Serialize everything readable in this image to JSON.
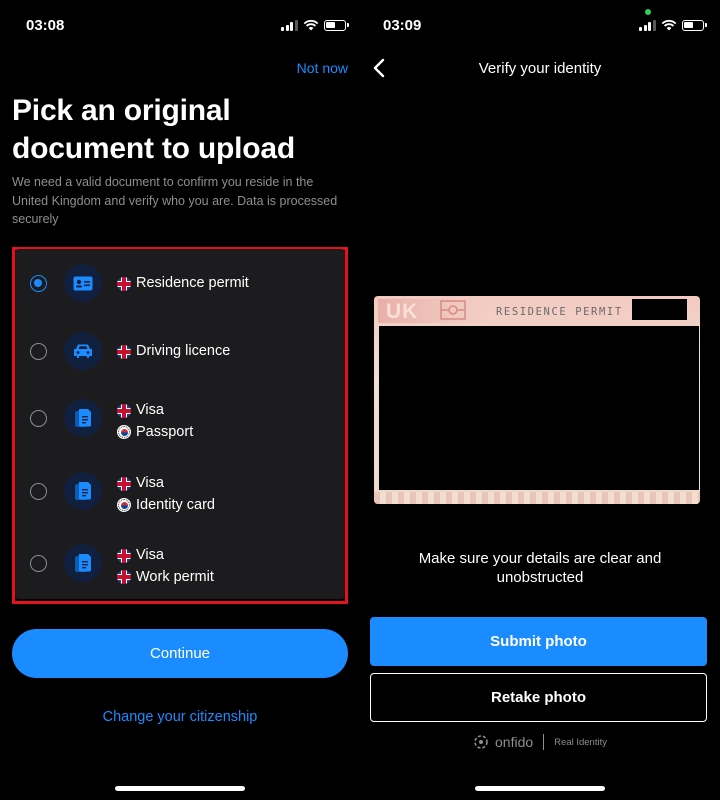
{
  "left_screen": {
    "status_bar": {
      "time": "03:08"
    },
    "header": {
      "not_now": "Not now"
    },
    "title": "Pick an original document to upload",
    "subtitle": "We need a valid document to confirm you reside in the United Kingdom and verify who you are. Data is processed securely",
    "documents": [
      {
        "selected": true,
        "icon": "id-card-icon",
        "lines": [
          {
            "flag": "uk-flag",
            "label": "Residence permit"
          }
        ]
      },
      {
        "selected": false,
        "icon": "car-icon",
        "lines": [
          {
            "flag": "uk-flag",
            "label": "Driving licence"
          }
        ]
      },
      {
        "selected": false,
        "icon": "document-stack-icon",
        "lines": [
          {
            "flag": "uk-flag",
            "label": "Visa"
          },
          {
            "flag": "south-korea-flag",
            "label": "Passport"
          }
        ]
      },
      {
        "selected": false,
        "icon": "document-stack-icon",
        "lines": [
          {
            "flag": "uk-flag",
            "label": "Visa"
          },
          {
            "flag": "south-korea-flag",
            "label": "Identity card"
          }
        ]
      },
      {
        "selected": false,
        "icon": "document-stack-icon",
        "lines": [
          {
            "flag": "uk-flag",
            "label": "Visa"
          },
          {
            "flag": "uk-flag",
            "label": "Work permit"
          }
        ]
      }
    ],
    "continue_button": "Continue",
    "change_citizenship": "Change your citizenship"
  },
  "right_screen": {
    "status_bar": {
      "time": "03:09"
    },
    "header": {
      "title": "Verify your identity"
    },
    "card_preview": {
      "country_text": "UK",
      "label": "RESIDENCE PERMIT"
    },
    "instruction": "Make sure your details are clear and unobstructed",
    "submit_button": "Submit photo",
    "retake_button": "Retake photo",
    "footer": {
      "brand": "onfido",
      "tagline": "Real Identity"
    }
  },
  "colors": {
    "accent": "#1a8cff",
    "highlight_border": "#e4121a",
    "list_background": "#1c1c1e",
    "secondary_text": "#8e8e93"
  }
}
